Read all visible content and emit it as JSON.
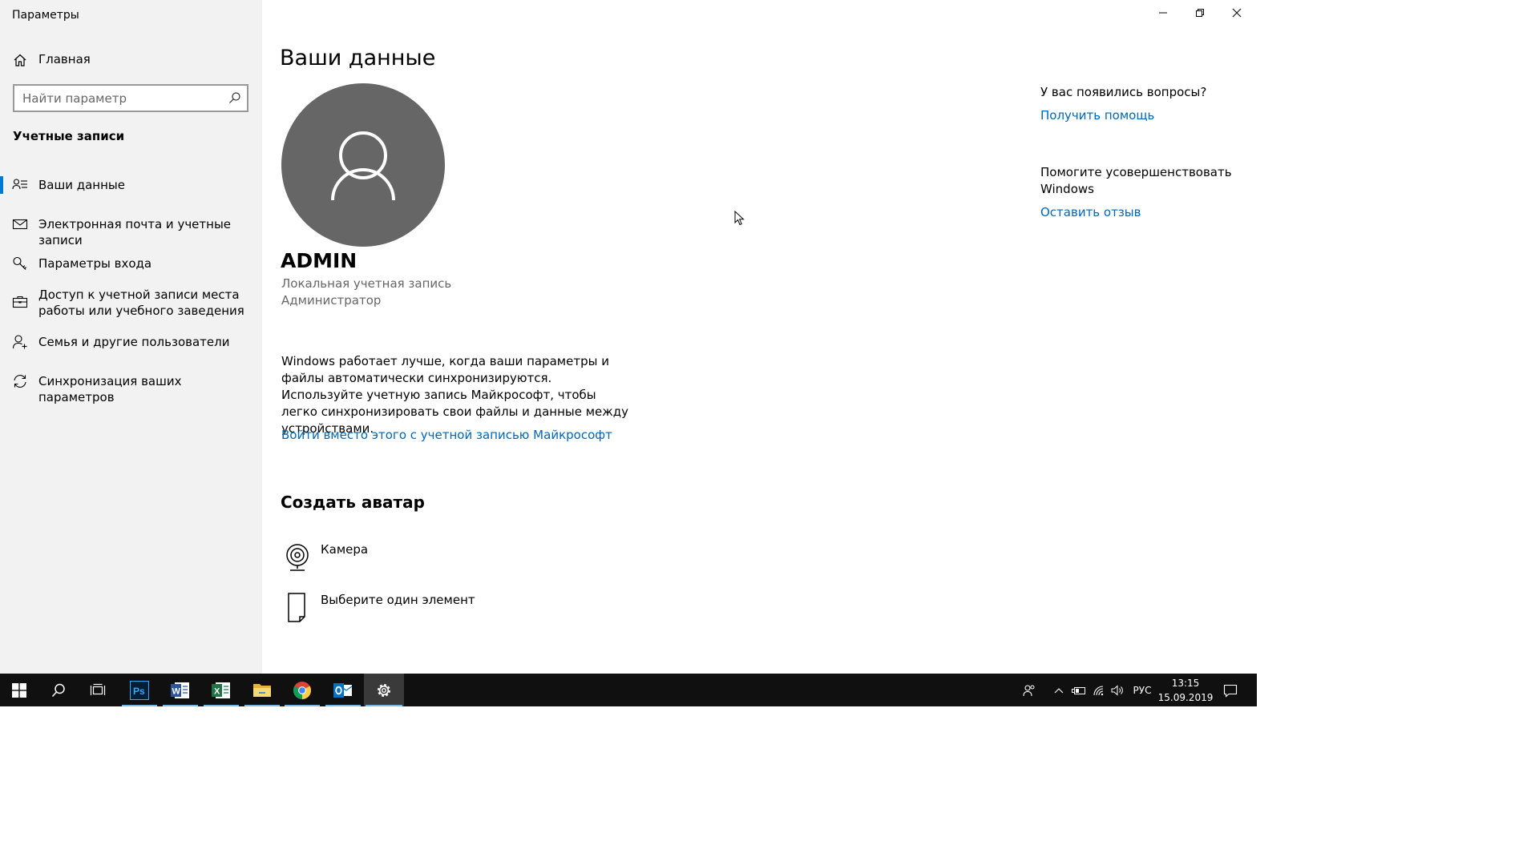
{
  "window": {
    "app_title": "Параметры",
    "controls": {
      "minimize": "minimize-icon",
      "restore": "restore-icon",
      "close": "close-icon"
    }
  },
  "sidebar": {
    "home_label": "Главная",
    "search_placeholder": "Найти параметр",
    "section_title": "Учетные записи",
    "items": [
      {
        "label": "Ваши данные",
        "icon": "person-list-icon",
        "active": true
      },
      {
        "label": "Электронная почта и учетные записи",
        "icon": "mail-icon",
        "active": false
      },
      {
        "label": "Параметры входа",
        "icon": "key-icon",
        "active": false
      },
      {
        "label": "Доступ к учетной записи места работы или учебного заведения",
        "icon": "briefcase-icon",
        "active": false
      },
      {
        "label": "Семья и другие пользователи",
        "icon": "person-add-icon",
        "active": false
      },
      {
        "label": "Синхронизация ваших параметров",
        "icon": "sync-icon",
        "active": false
      }
    ]
  },
  "main": {
    "title": "Ваши данные",
    "user_name": "ADMIN",
    "account_type": "Локальная учетная запись",
    "account_role": "Администратор",
    "info_text": "Windows работает лучше, когда ваши параметры и файлы автоматически синхронизируются. Используйте учетную запись Майкрософт, чтобы легко синхронизировать свои файлы и данные между устройствами.",
    "ms_link": "Войти вместо этого с учетной записью Майкрософт",
    "create_avatar_title": "Создать аватар",
    "options": [
      {
        "label": "Камера",
        "icon": "camera-icon"
      },
      {
        "label": "Выберите один элемент",
        "icon": "browse-file-icon"
      }
    ]
  },
  "help": {
    "question": "У вас появились вопросы?",
    "help_link": "Получить помощь",
    "improve_text": "Помогите усовершенствовать Windows",
    "feedback_link": "Оставить отзыв"
  },
  "taskbar": {
    "apps": [
      {
        "name": "start-button",
        "icon": "windows-logo-icon"
      },
      {
        "name": "search-button",
        "icon": "search-icon"
      },
      {
        "name": "task-view-button",
        "icon": "task-view-icon"
      },
      {
        "name": "photoshop-button",
        "icon": "photoshop-icon"
      },
      {
        "name": "word-button",
        "icon": "word-icon"
      },
      {
        "name": "excel-button",
        "icon": "excel-icon"
      },
      {
        "name": "explorer-button",
        "icon": "folder-icon"
      },
      {
        "name": "chrome-button",
        "icon": "chrome-icon"
      },
      {
        "name": "outlook-button",
        "icon": "outlook-icon"
      },
      {
        "name": "settings-button",
        "icon": "gear-icon"
      }
    ],
    "language": "РУС",
    "time": "13:15",
    "date": "15.09.2019"
  },
  "colors": {
    "accent": "#0078d7",
    "link": "#0067b8",
    "sidebar_bg": "#f2f2f2",
    "taskbar_bg": "#101010",
    "avatar_bg": "#666666"
  }
}
